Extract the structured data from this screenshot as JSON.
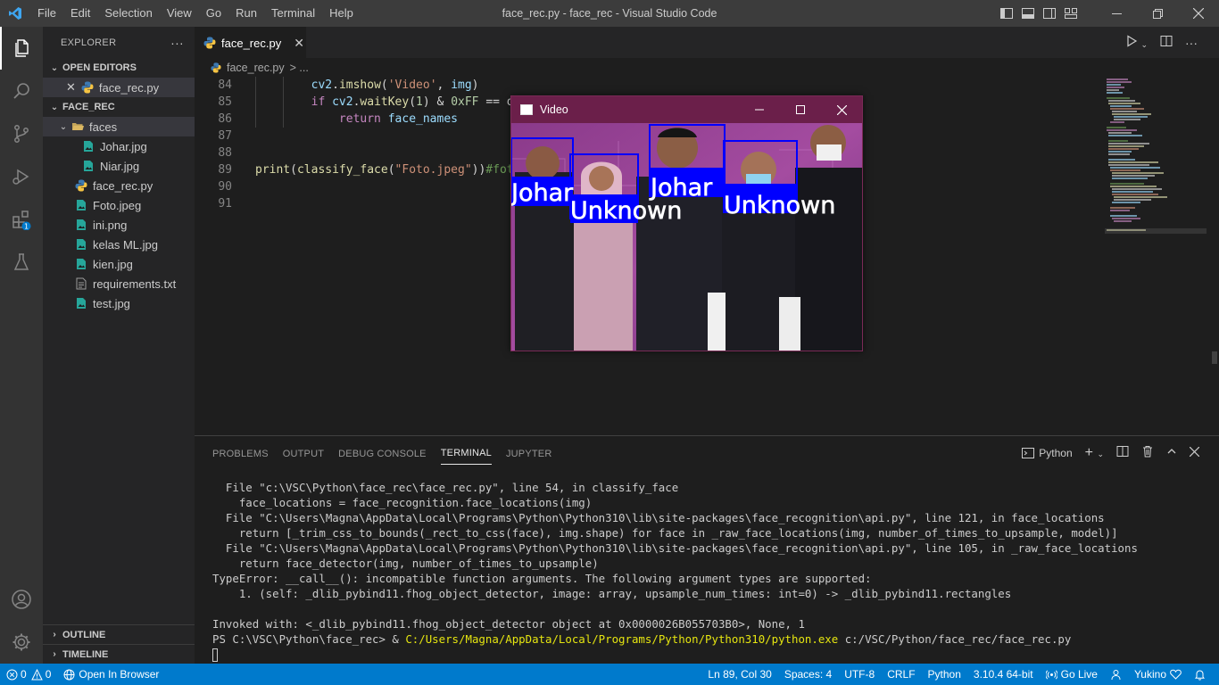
{
  "window_title": "face_rec.py - face_rec - Visual Studio Code",
  "menu": [
    "File",
    "Edit",
    "Selection",
    "View",
    "Go",
    "Run",
    "Terminal",
    "Help"
  ],
  "sidebar": {
    "title": "EXPLORER",
    "more": "···",
    "open_editors_label": "OPEN EDITORS",
    "open_editors": [
      {
        "name": "face_rec.py"
      }
    ],
    "project_label": "FACE_REC",
    "tree": [
      {
        "name": "faces",
        "type": "folder"
      },
      {
        "name": "Johar.jpg",
        "type": "image",
        "indent": 2
      },
      {
        "name": "Niar.jpg",
        "type": "image",
        "indent": 2
      },
      {
        "name": "face_rec.py",
        "type": "python",
        "indent": 1
      },
      {
        "name": "Foto.jpeg",
        "type": "image",
        "indent": 1
      },
      {
        "name": "ini.png",
        "type": "image",
        "indent": 1
      },
      {
        "name": "kelas ML.jpg",
        "type": "image",
        "indent": 1
      },
      {
        "name": "kien.jpg",
        "type": "image",
        "indent": 1
      },
      {
        "name": "requirements.txt",
        "type": "text",
        "indent": 1
      },
      {
        "name": "test.jpg",
        "type": "image",
        "indent": 1
      }
    ],
    "outline_label": "OUTLINE",
    "timeline_label": "TIMELINE"
  },
  "editor": {
    "tab_label": "face_rec.py",
    "breadcrumb_file": "face_rec.py",
    "breadcrumb_sep": "> ...",
    "line_numbers": [
      "84",
      "85",
      "86",
      "87",
      "88",
      "89",
      "90",
      "91"
    ]
  },
  "video_window": {
    "title": "Video",
    "labels": [
      "Johar",
      "Unknown",
      "Johar",
      "Unknown"
    ]
  },
  "panel": {
    "tabs": [
      "PROBLEMS",
      "OUTPUT",
      "DEBUG CONSOLE",
      "TERMINAL",
      "JUPYTER"
    ],
    "active_tab": "TERMINAL",
    "terminal_name": "Python",
    "lines": [
      "  File \"c:\\VSC\\Python\\face_rec\\face_rec.py\", line 54, in classify_face",
      "    face_locations = face_recognition.face_locations(img)",
      "  File \"C:\\Users\\Magna\\AppData\\Local\\Programs\\Python\\Python310\\lib\\site-packages\\face_recognition\\api.py\", line 121, in face_locations",
      "    return [_trim_css_to_bounds(_rect_to_css(face), img.shape) for face in _raw_face_locations(img, number_of_times_to_upsample, model)]",
      "  File \"C:\\Users\\Magna\\AppData\\Local\\Programs\\Python\\Python310\\lib\\site-packages\\face_recognition\\api.py\", line 105, in _raw_face_locations",
      "    return face_detector(img, number_of_times_to_upsample)",
      "TypeError: __call__(): incompatible function arguments. The following argument types are supported:",
      "    1. (self: _dlib_pybind11.fhog_object_detector, image: array, upsample_num_times: int=0) -> _dlib_pybind11.rectangles",
      "",
      "Invoked with: <_dlib_pybind11.fhog_object_detector object at 0x0000026B055703B0>, None, 1"
    ],
    "prompt": "PS C:\\VSC\\Python\\face_rec> & ",
    "command_path": "C:/Users/Magna/AppData/Local/Programs/Python/Python310/python.exe",
    "command_arg": " c:/VSC/Python/face_rec/face_rec.py"
  },
  "status": {
    "errors": "0",
    "warnings": "0",
    "open_browser": "Open In Browser",
    "position": "Ln 89, Col 30",
    "spaces": "Spaces: 4",
    "encoding": "UTF-8",
    "eol": "CRLF",
    "language": "Python",
    "interpreter": "3.10.4 64-bit",
    "go_live": "Go Live",
    "user": "Yukino"
  },
  "colors": {
    "accent": "#007acc",
    "titlebar": "#3c3c3c",
    "video_titlebar": "#6b1f4a",
    "detection_box": "#0000ff"
  }
}
